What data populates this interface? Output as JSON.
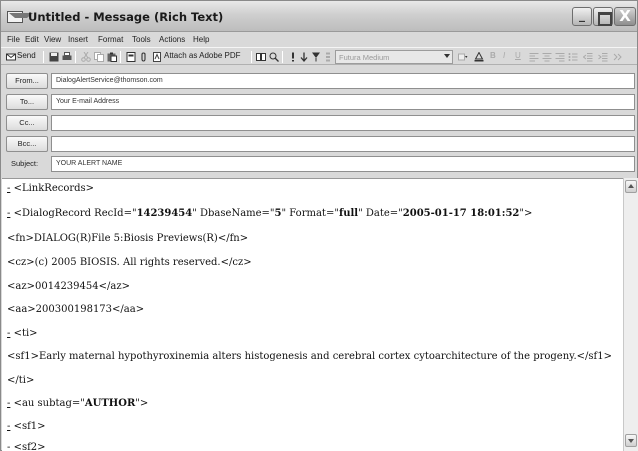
{
  "window": {
    "title": "Untitled - Message (Rich Text)",
    "min_label": "_",
    "close_label": "X"
  },
  "menu": {
    "items": [
      "File",
      "Edit",
      "View",
      "Insert",
      "Format",
      "Tools",
      "Actions",
      "Help"
    ]
  },
  "toolbar": {
    "send_label": "Send",
    "attach_pdf_label": "Attach as Adobe PDF",
    "font_name": "Futura Medium",
    "bold": "B",
    "italic": "I",
    "underline": "U"
  },
  "header": {
    "from_label": "From...",
    "from_value": "DialogAlertService@thomson.com",
    "to_label": "To...",
    "to_value": "Your E-mail Address",
    "cc_label": "Cc...",
    "cc_value": "",
    "bcc_label": "Bcc...",
    "bcc_value": "",
    "subject_label": "Subject:",
    "subject_value": "YOUR ALERT NAME"
  },
  "body": {
    "lines": [
      {
        "dash": "-",
        "pre": " <LinkRecords>"
      },
      {
        "dash": "-",
        "pre": " <DialogRecord RecId=\"",
        "b1": "14239454",
        "mid1": "\" DbaseName=\"",
        "b2": "5",
        "mid2": "\" Format=\"",
        "b3": "full",
        "mid3": "\" Date=\"",
        "b4": "2005-01-17 18:01:52",
        "post": "\">"
      },
      {
        "pre": "<fn>DIALOG(R)File 5:Biosis Previews(R)</fn>"
      },
      {
        "pre": "<cz>(c) 2005 BIOSIS. All rights reserved.</cz>"
      },
      {
        "pre": "<az>0014239454</az>"
      },
      {
        "pre": "<aa>200300198173</aa>"
      },
      {
        "dash": "-",
        "pre": " <ti>"
      },
      {
        "pre": "<sf1>Early maternal hypothyroxinemia alters histogenesis and cerebral cortex cytoarchitecture of the progeny.</sf1>"
      },
      {
        "pre": "</ti>"
      },
      {
        "dash": "-",
        "pre": " <au subtag=\"",
        "b1": "AUTHOR",
        "post": "\">"
      },
      {
        "dash": "-",
        "pre": " <sf1>"
      },
      {
        "dash": "-",
        "pre": " <sf2>"
      }
    ]
  },
  "colors": {
    "window_bg": "#d9d9d9",
    "body_bg": "#ffffff"
  }
}
